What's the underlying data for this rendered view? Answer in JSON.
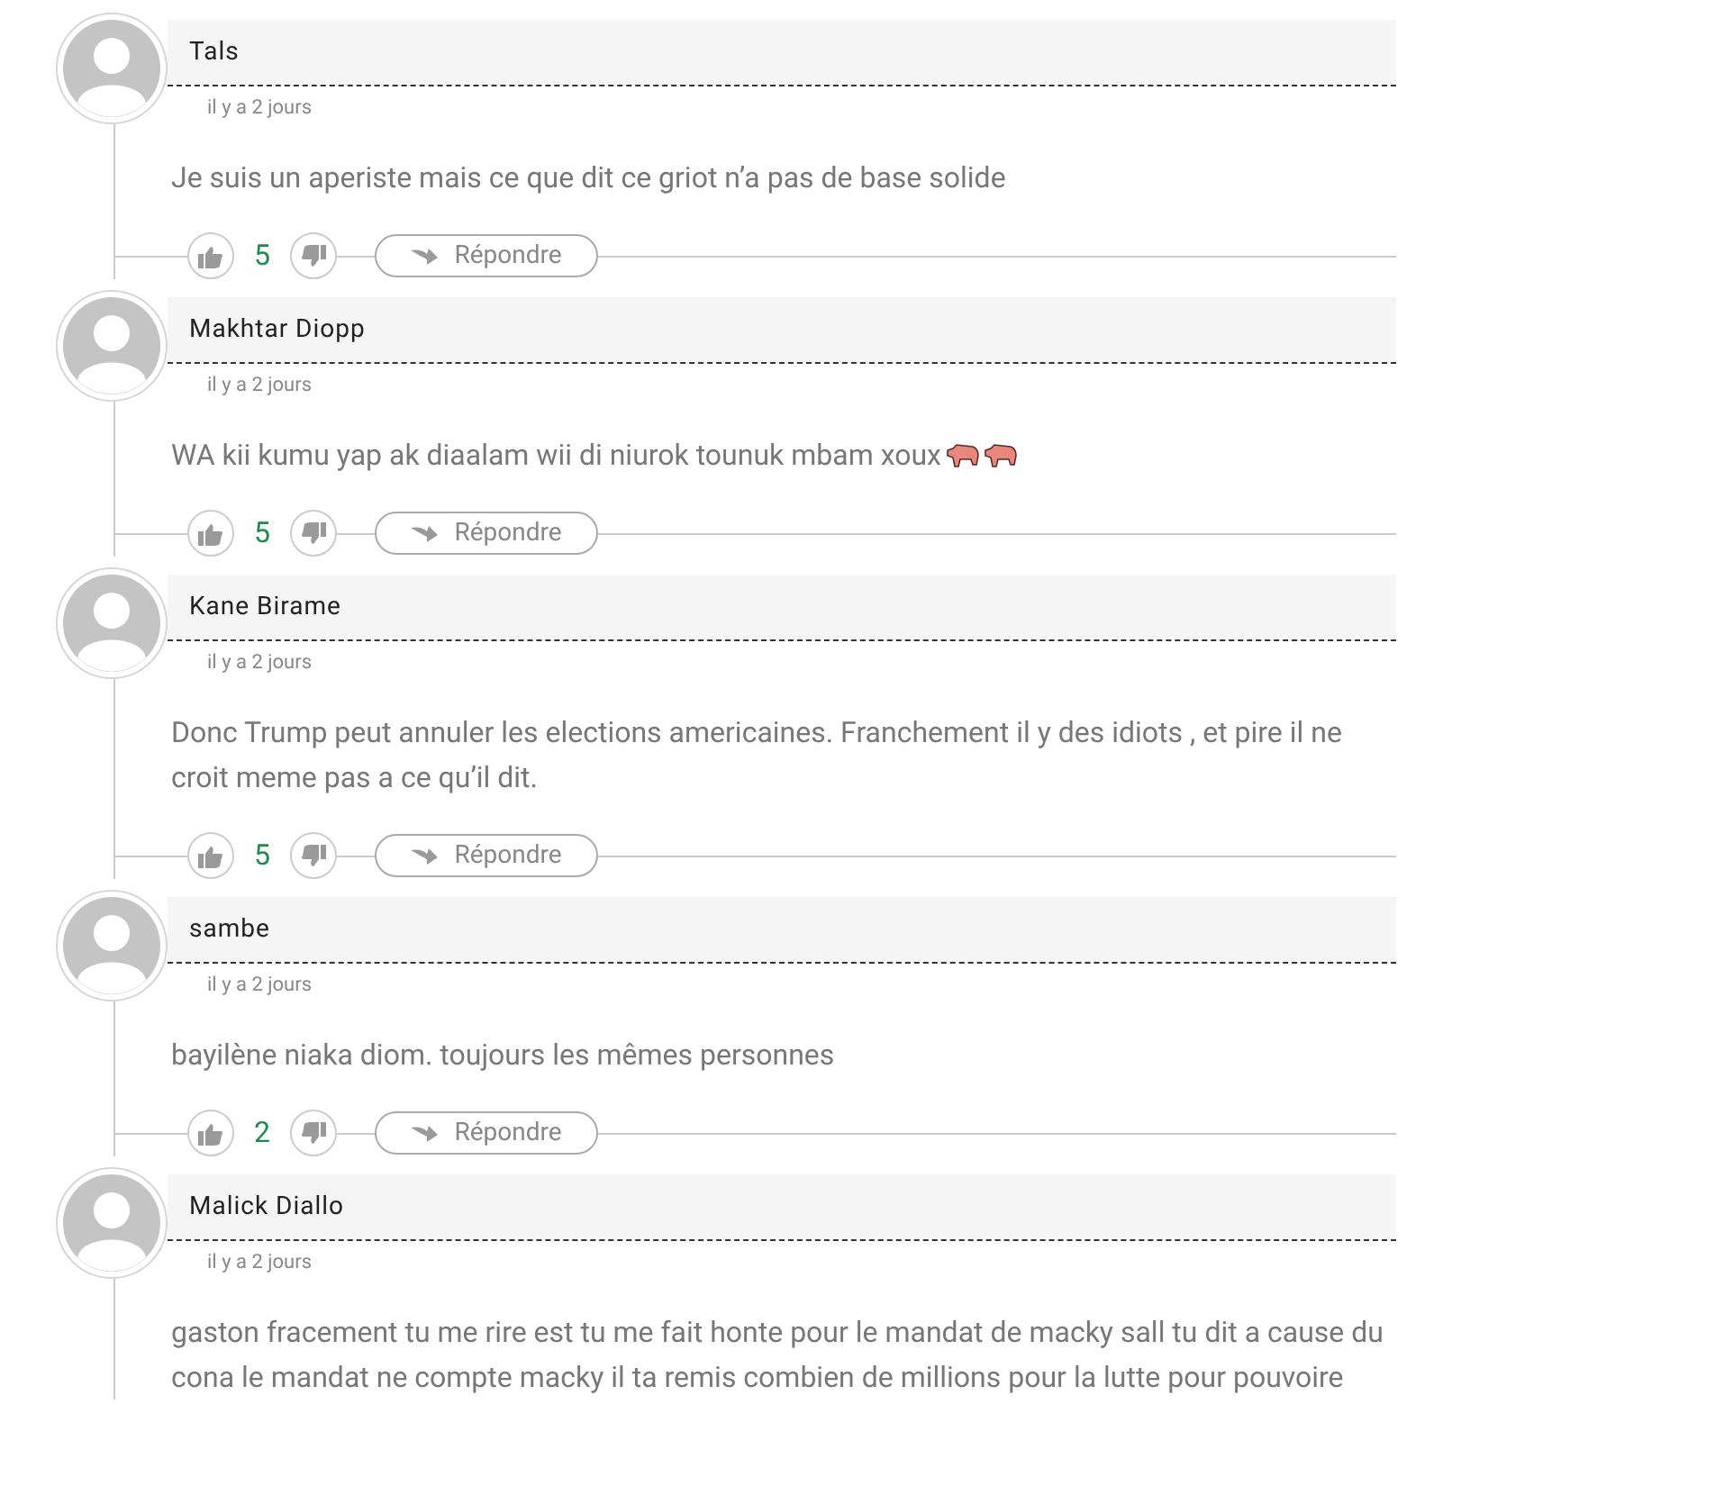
{
  "comments": [
    {
      "author": "Tals",
      "time": "il y a 2 jours",
      "text": "Je suis un aperiste mais ce que dit ce griot n’a pas de base solide",
      "likes": "5",
      "reply_label": "Répondre"
    },
    {
      "author": "Makhtar Diopp",
      "time": "il y a 2 jours",
      "text": "WA kii kumu yap ak diaalam wii di niurok tounuk mbam xoux",
      "trailing_icons": [
        {
          "kind": "pig"
        },
        {
          "kind": "pig"
        }
      ],
      "likes": "5",
      "reply_label": "Répondre"
    },
    {
      "author": "Kane Birame",
      "time": "il y a 2 jours",
      "text": "Donc Trump peut annuler les elections americaines. Franchement il y des idiots , et pire il ne croit meme pas a ce qu’il dit.",
      "likes": "5",
      "reply_label": "Répondre"
    },
    {
      "author": "sambe",
      "time": "il y a 2 jours",
      "text": "bayilène niaka diom. toujours les mêmes personnes",
      "likes": "2",
      "reply_label": "Répondre"
    },
    {
      "author": "Malick Diallo",
      "time": "il y a 2 jours",
      "text": "gaston fracement tu me rire est tu me fait honte pour le mandat de macky sall tu dit a cause du cona le mandat ne compte macky il ta remis combien de millions pour la lutte pour pouvoire"
    }
  ]
}
